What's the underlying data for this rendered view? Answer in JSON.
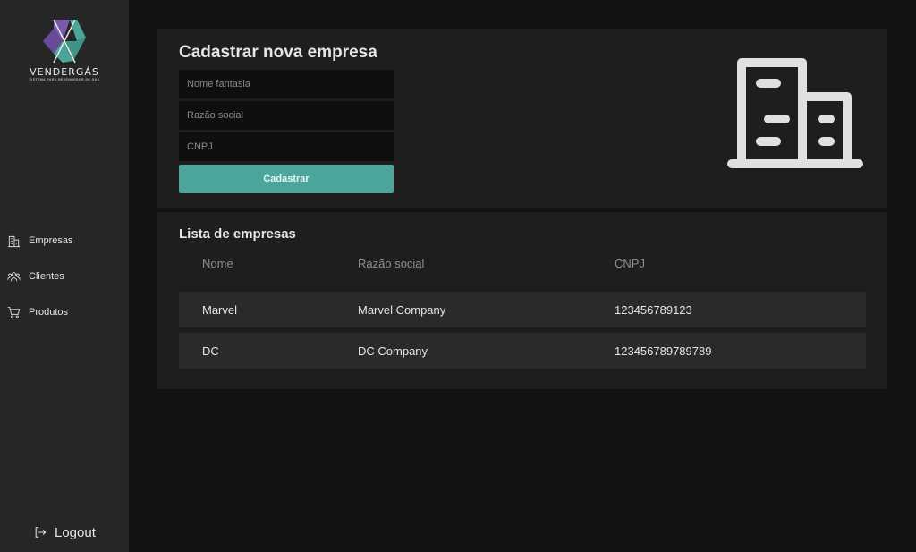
{
  "brand": {
    "name": "VENDERGÁS",
    "tagline": "SISTEMA PARA REVENDEDOR DE GÁS",
    "colors": {
      "purple": "#7a5aa8",
      "teal": "#4ba59a"
    }
  },
  "sidebar": {
    "items": [
      {
        "label": "Empresas",
        "icon": "building-icon"
      },
      {
        "label": "Clientes",
        "icon": "users-icon"
      },
      {
        "label": "Produtos",
        "icon": "cart-icon"
      }
    ],
    "logout_label": "Logout"
  },
  "form": {
    "title": "Cadastrar nova empresa",
    "fields": [
      {
        "placeholder": "Nome fantasia",
        "value": ""
      },
      {
        "placeholder": "Razão social",
        "value": ""
      },
      {
        "placeholder": "CNPJ",
        "value": ""
      }
    ],
    "submit_label": "Cadastrar",
    "illustration": "buildings-icon"
  },
  "list": {
    "title": "Lista de empresas",
    "columns": [
      "Nome",
      "Razão social",
      "CNPJ"
    ],
    "rows": [
      [
        "Marvel",
        "Marvel Company",
        "123456789123"
      ],
      [
        "DC",
        "DC Company",
        "123456789789789"
      ]
    ]
  },
  "theme": {
    "accent": "#4ba59a",
    "background": "#121212",
    "sidebar": "#262626",
    "card": "#1e1e1e"
  }
}
